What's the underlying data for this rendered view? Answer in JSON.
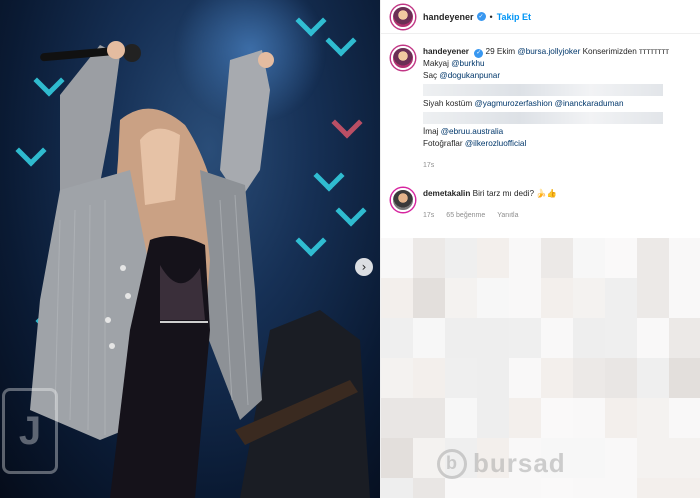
{
  "header": {
    "username": "handeyener",
    "follow_label": "Takip Et",
    "separator": "•"
  },
  "caption": {
    "username": "handeyener",
    "line1_text": "29 Ekim",
    "line1_mention": "@bursa.jollyjoker",
    "line1_tail": "Konserimizden ᴛᴛᴛᴛᴛᴛᴛᴛ",
    "makyaj_label": "Makyaj",
    "makyaj_mention": "@burkhu",
    "sac_label": "Saç",
    "sac_mention": "@dogukanpunar",
    "kostum_label": "Siyah kostüm",
    "kostum_mention1": "@yagmurozerfashion",
    "kostum_mention2": "@inanckaraduman",
    "imaj_label": "İmaj",
    "imaj_mention": "@ebruu.australia",
    "foto_label": "Fotoğraflar",
    "foto_mention": "@ilkerozluofficial",
    "time": "17s"
  },
  "comment": {
    "username": "demetakalin",
    "text": "Biri tarz mı dedi? 🍌👍",
    "time": "17s",
    "likes": "65 beğenme",
    "reply": "Yanıtla"
  },
  "media": {
    "next_icon": "chevron-right-icon",
    "next_glyph": "›",
    "watermark_left": "J"
  },
  "watermark": {
    "logo_letter": "b",
    "text": "bursad"
  },
  "colors": {
    "accent": "#0095f6",
    "mention": "#00376b",
    "muted": "#8e8e8e",
    "stage_cyan": "#35d6e8"
  }
}
